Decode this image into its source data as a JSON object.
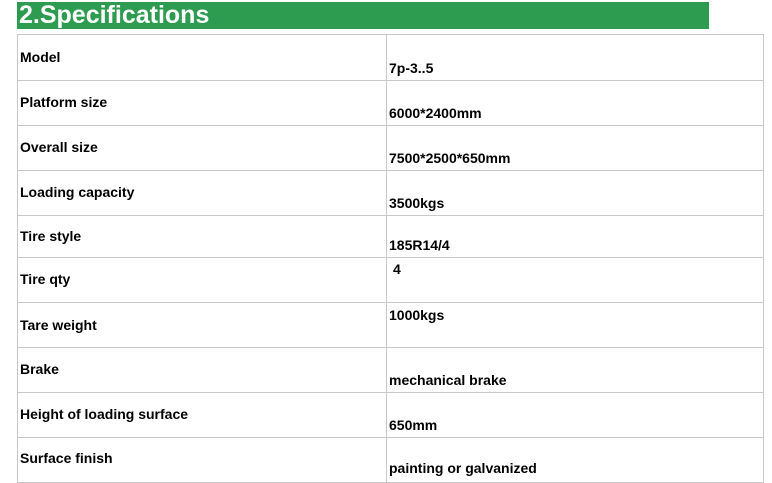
{
  "section": {
    "title": "2.Specifications"
  },
  "specs": [
    {
      "label": "Model",
      "value": "7p-3..5"
    },
    {
      "label": "Platform size",
      "value": "6000*2400mm"
    },
    {
      "label": "Overall size",
      "value": "7500*2500*650mm"
    },
    {
      "label": "Loading capacity",
      "value": "3500kgs"
    },
    {
      "label": "Tire style",
      "value": "185R14/4"
    },
    {
      "label": "Tire qty",
      "value": "4"
    },
    {
      "label": "Tare weight",
      "value": "1000kgs"
    },
    {
      "label": "Brake",
      "value": "mechanical brake"
    },
    {
      "label": "Height of loading surface",
      "value": "650mm"
    },
    {
      "label": "Surface finish",
      "value": "painting or galvanized"
    }
  ],
  "colors": {
    "banner": "#2e9c50",
    "grid": "#c8c8c8"
  }
}
